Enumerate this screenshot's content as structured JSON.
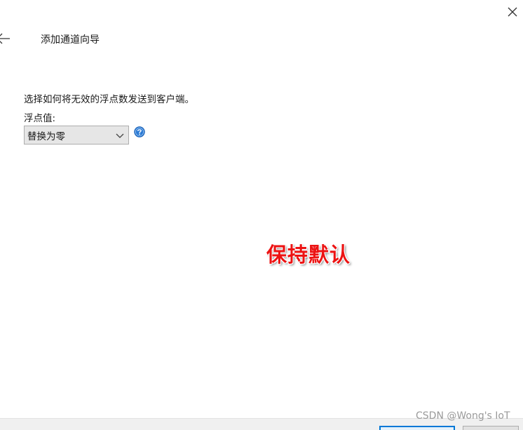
{
  "header": {
    "title": "添加通道向导",
    "back_icon": "arrow-left-icon",
    "close_icon": "close-icon"
  },
  "main": {
    "instruction": "选择如何将无效的浮点数发送到客户端。",
    "field_label": "浮点值:",
    "select": {
      "value": "替换为零",
      "caret_icon": "chevron-down-icon"
    },
    "help_icon": "question-circle-icon"
  },
  "annotation": {
    "text": "保持默认",
    "color": "#ec1313"
  },
  "watermark": "CSDN @Wong's IoT",
  "colors": {
    "accent": "#0078d7",
    "help": "#2b7bd6"
  }
}
